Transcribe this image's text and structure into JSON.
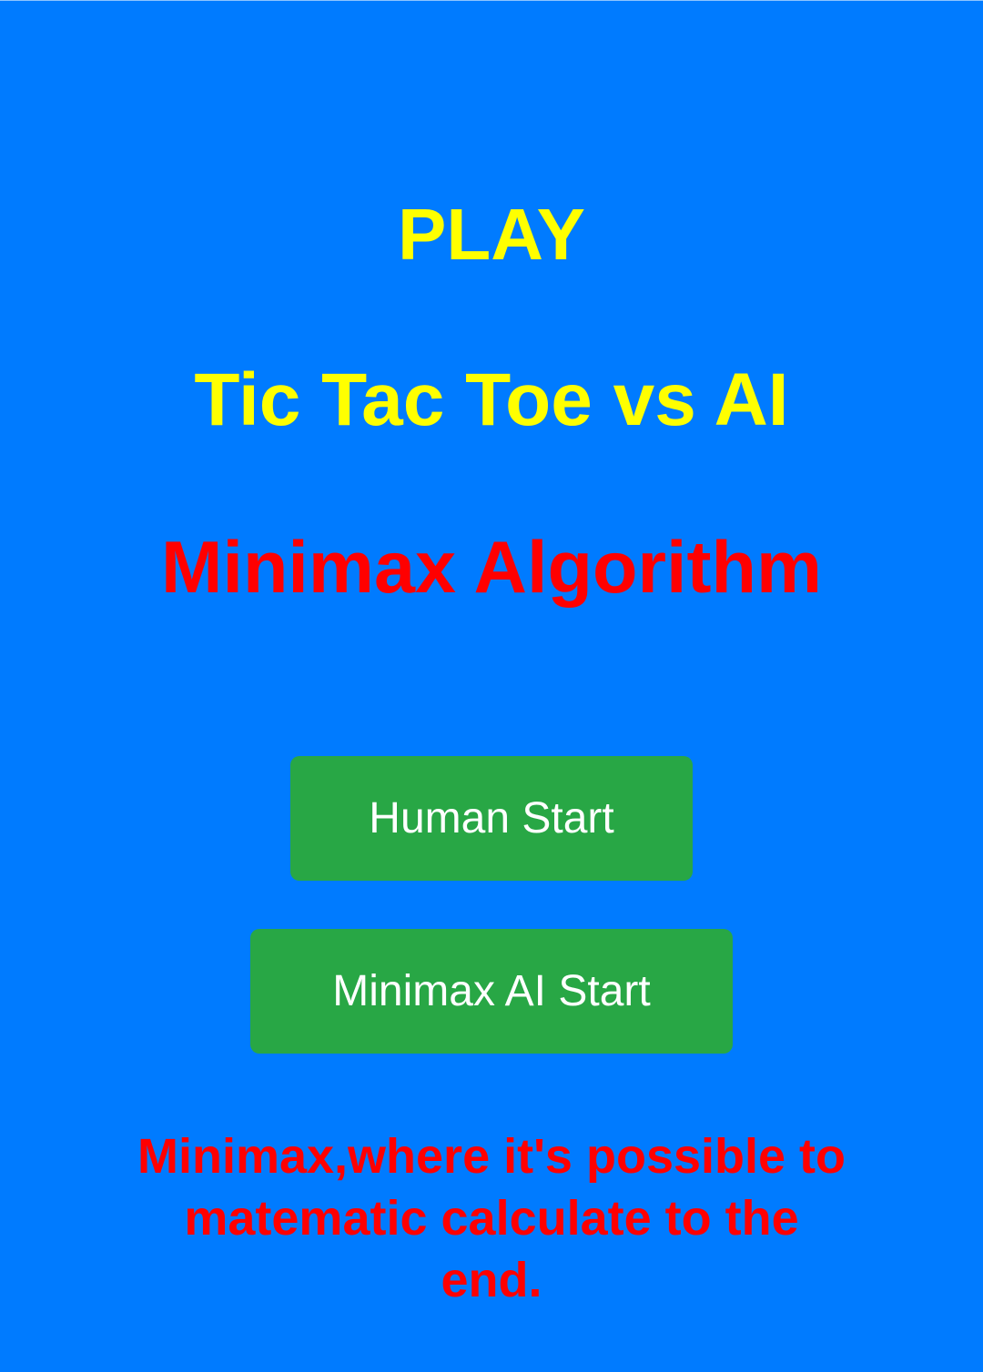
{
  "screen": {
    "background_color": "#007bff",
    "title_color": "#ffff00",
    "accent_color": "#ff0000",
    "button_color": "#28a745",
    "button_text_color": "#ffffff"
  },
  "header": {
    "play_label": "PLAY",
    "game_title": "Tic Tac Toe vs AI",
    "algorithm_title": "Minimax Algorithm"
  },
  "buttons": {
    "human_start": "Human Start",
    "minimax_ai_start": "Minimax AI Start"
  },
  "footer": {
    "description": "Minimax,where it's possible to matematic calculate to the end."
  }
}
